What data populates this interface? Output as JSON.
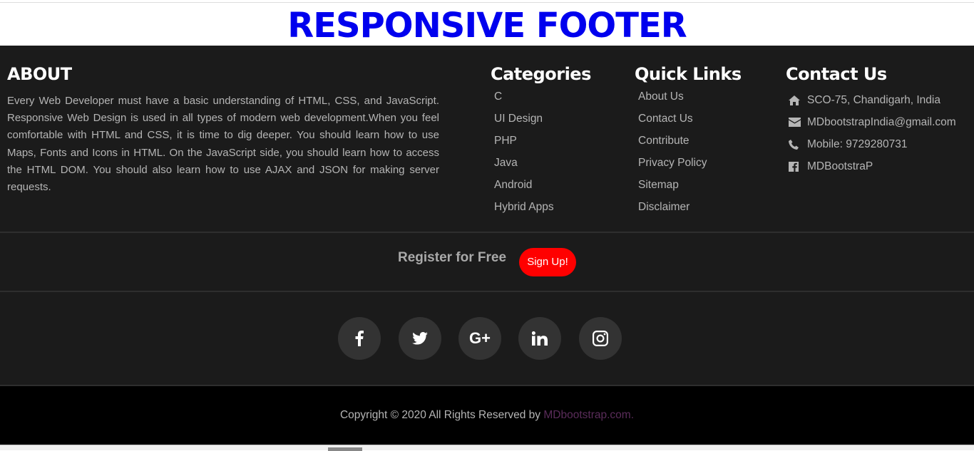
{
  "page": {
    "title": "RESPONSIVE FOOTER",
    "title_color": "#0000ee"
  },
  "about": {
    "heading": "ABOUT",
    "text": "Every Web Developer must have a basic understanding of HTML, CSS, and JavaScript. Responsive Web Design is used in all types of modern web development.When you feel comfortable with HTML and CSS, it is time to dig deeper. You should learn how to use Maps, Fonts and Icons in HTML. On the JavaScript side, you should learn how to access the HTML DOM. You should also learn how to use AJAX and JSON for making server requests."
  },
  "categories": {
    "heading": "Categories",
    "items": [
      "C",
      "UI Design",
      "PHP",
      "Java",
      "Android",
      "Hybrid Apps"
    ]
  },
  "quick_links": {
    "heading": "Quick Links",
    "items": [
      "About Us",
      "Contact Us",
      "Contribute",
      "Privacy Policy",
      "Sitemap",
      "Disclaimer"
    ]
  },
  "contact": {
    "heading": "Contact Us",
    "items": [
      {
        "icon": "home-icon",
        "text": "SCO-75, Chandigarh, India"
      },
      {
        "icon": "envelope-icon",
        "text": "MDbootstrapIndia@gmail.com"
      },
      {
        "icon": "phone-icon",
        "text": "Mobile: 9729280731"
      },
      {
        "icon": "facebook-square-icon",
        "text": "MDBootstraP"
      }
    ]
  },
  "register": {
    "label": "Register for Free",
    "button": "Sign Up!",
    "button_color": "#ff0000"
  },
  "social": [
    "facebook-icon",
    "twitter-icon",
    "google-plus-icon",
    "linkedin-icon",
    "instagram-icon"
  ],
  "footer_bottom": {
    "copyright": "Copyright © 2020 All Rights Reserved by ",
    "link": "MDbootstrap.com."
  }
}
